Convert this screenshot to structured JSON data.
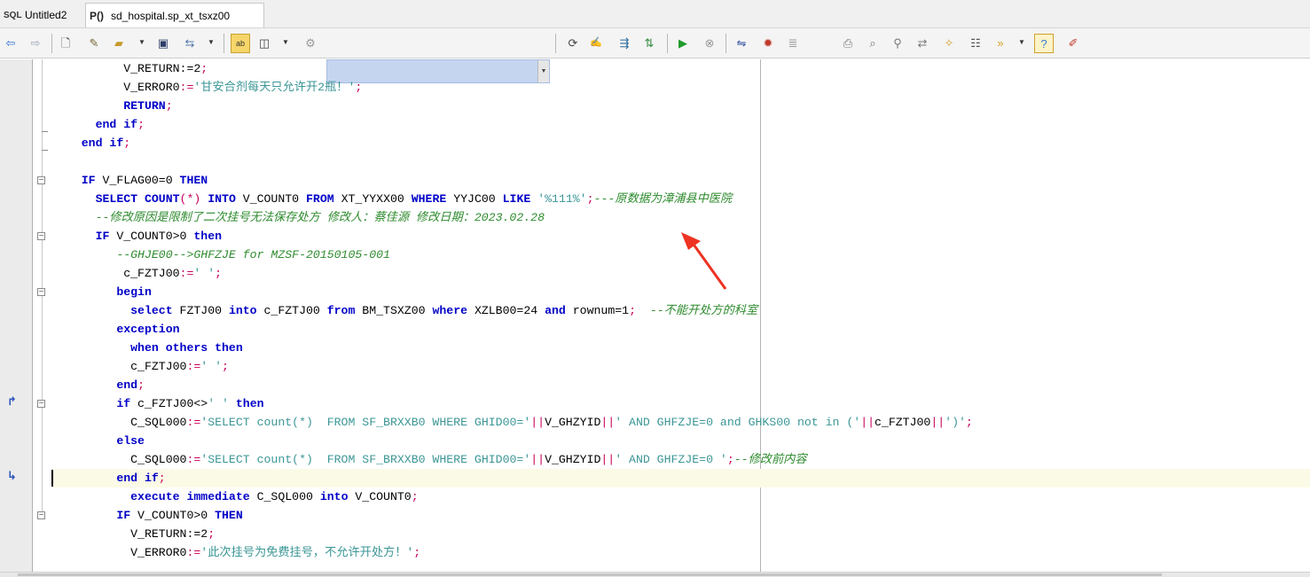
{
  "tabs": [
    {
      "label": "Untitled2",
      "icon": "sql-file-icon"
    },
    {
      "label": "sd_hospital.sp_xt_tsxz00",
      "icon": "procedure-icon",
      "icon_text": "P()"
    }
  ],
  "toolbar": {
    "icons": [
      "back-arrow-icon",
      "forward-arrow-icon",
      "new-file-icon",
      "open-folder-icon",
      "save-icon",
      "export-icon",
      "text-format-icon",
      "split-window-icon",
      "object-icon",
      "refresh-icon",
      "sql-script-icon",
      "send-icon",
      "compare-icon",
      "run-icon",
      "stop-icon",
      "debug-icon",
      "bug-icon",
      "indent-icon",
      "print-icon",
      "print-preview-icon",
      "find-icon",
      "replace-icon",
      "clean-icon",
      "schema-icon",
      "macro-icon",
      "help-icon",
      "pen-icon"
    ],
    "combo_value": ""
  },
  "colors": {
    "keyword": "#0000c8",
    "string": "#3c9696",
    "comment": "#2e8b2e",
    "operator": "#c8005a",
    "arrow": "#ee3322",
    "current_line": "#fbfae6"
  },
  "code_lines": [
    [
      {
        "t": "         V_RETURN:=2",
        "c": "plain"
      },
      {
        "t": ";",
        "c": "op"
      }
    ],
    [
      {
        "t": "         V_ERROR0",
        "c": "plain"
      },
      {
        "t": ":=",
        "c": "op"
      },
      {
        "t": "'甘安合剂每天只允许开2瓶！'",
        "c": "str"
      },
      {
        "t": ";",
        "c": "op"
      }
    ],
    [
      {
        "t": "         RETURN",
        "c": "kw"
      },
      {
        "t": ";",
        "c": "op"
      }
    ],
    [
      {
        "t": "     ",
        "c": "plain"
      },
      {
        "t": "end if",
        "c": "kw"
      },
      {
        "t": ";",
        "c": "op"
      }
    ],
    [
      {
        "t": "   ",
        "c": "plain"
      },
      {
        "t": "end if",
        "c": "kw"
      },
      {
        "t": ";",
        "c": "op"
      }
    ],
    [
      {
        "t": "",
        "c": "plain"
      }
    ],
    [
      {
        "t": "   ",
        "c": "plain"
      },
      {
        "t": "IF",
        "c": "kw"
      },
      {
        "t": " V_FLAG00=0 ",
        "c": "plain"
      },
      {
        "t": "THEN",
        "c": "kw"
      }
    ],
    [
      {
        "t": "     ",
        "c": "plain"
      },
      {
        "t": "SELECT COUNT",
        "c": "kw"
      },
      {
        "t": "(*)",
        "c": "op"
      },
      {
        "t": " INTO ",
        "c": "kw"
      },
      {
        "t": "V_COUNT0 ",
        "c": "plain"
      },
      {
        "t": "FROM",
        "c": "kw"
      },
      {
        "t": " XT_YYXX00 ",
        "c": "plain"
      },
      {
        "t": "WHERE",
        "c": "kw"
      },
      {
        "t": " YYJC00 ",
        "c": "plain"
      },
      {
        "t": "LIKE",
        "c": "kw"
      },
      {
        "t": " ",
        "c": "plain"
      },
      {
        "t": "'%111%'",
        "c": "str"
      },
      {
        "t": ";",
        "c": "op"
      },
      {
        "t": "---原数据为漳浦县中医院",
        "c": "cmt"
      }
    ],
    [
      {
        "t": "     ",
        "c": "plain"
      },
      {
        "t": "--修改原因是限制了二次挂号无法保存处方 修改人：蔡佳源 修改日期：2023.02.28",
        "c": "cmt"
      }
    ],
    [
      {
        "t": "     ",
        "c": "plain"
      },
      {
        "t": "IF",
        "c": "kw"
      },
      {
        "t": " V_COUNT0>0 ",
        "c": "plain"
      },
      {
        "t": "then",
        "c": "kw"
      }
    ],
    [
      {
        "t": "        ",
        "c": "plain"
      },
      {
        "t": "--GHJE00-->GHFZJE for MZSF-20150105-001",
        "c": "cmt"
      }
    ],
    [
      {
        "t": "         c_FZTJ00",
        "c": "plain"
      },
      {
        "t": ":=",
        "c": "op"
      },
      {
        "t": "' '",
        "c": "str"
      },
      {
        "t": ";",
        "c": "op"
      }
    ],
    [
      {
        "t": "        ",
        "c": "plain"
      },
      {
        "t": "begin",
        "c": "kw"
      }
    ],
    [
      {
        "t": "          ",
        "c": "plain"
      },
      {
        "t": "select",
        "c": "kw"
      },
      {
        "t": " FZTJ00 ",
        "c": "plain"
      },
      {
        "t": "into",
        "c": "kw"
      },
      {
        "t": " c_FZTJ00 ",
        "c": "plain"
      },
      {
        "t": "from",
        "c": "kw"
      },
      {
        "t": " BM_TSXZ00 ",
        "c": "plain"
      },
      {
        "t": "where",
        "c": "kw"
      },
      {
        "t": " XZLB00=24 ",
        "c": "plain"
      },
      {
        "t": "and",
        "c": "kw"
      },
      {
        "t": " rownum=1",
        "c": "plain"
      },
      {
        "t": ";",
        "c": "op"
      },
      {
        "t": "  ",
        "c": "plain"
      },
      {
        "t": "--不能开处方的科室",
        "c": "cmt"
      }
    ],
    [
      {
        "t": "        ",
        "c": "plain"
      },
      {
        "t": "exception",
        "c": "kw"
      }
    ],
    [
      {
        "t": "          ",
        "c": "plain"
      },
      {
        "t": "when others then",
        "c": "kw"
      }
    ],
    [
      {
        "t": "          c_FZTJ00",
        "c": "plain"
      },
      {
        "t": ":=",
        "c": "op"
      },
      {
        "t": "' '",
        "c": "str"
      },
      {
        "t": ";",
        "c": "op"
      }
    ],
    [
      {
        "t": "        ",
        "c": "plain"
      },
      {
        "t": "end",
        "c": "kw"
      },
      {
        "t": ";",
        "c": "op"
      }
    ],
    [
      {
        "t": "        ",
        "c": "plain"
      },
      {
        "t": "if",
        "c": "kw"
      },
      {
        "t": " c_FZTJ00<>",
        "c": "plain"
      },
      {
        "t": "' '",
        "c": "str"
      },
      {
        "t": " ",
        "c": "plain"
      },
      {
        "t": "then",
        "c": "kw"
      }
    ],
    [
      {
        "t": "          C_SQL000",
        "c": "plain"
      },
      {
        "t": ":=",
        "c": "op"
      },
      {
        "t": "'SELECT count(*)  FROM SF_BRXXB0 WHERE GHID00='",
        "c": "str"
      },
      {
        "t": "||",
        "c": "op"
      },
      {
        "t": "V_GHZYID",
        "c": "plain"
      },
      {
        "t": "||",
        "c": "op"
      },
      {
        "t": "' AND GHFZJE=0 and GHKS00 not in ('",
        "c": "str"
      },
      {
        "t": "||",
        "c": "op"
      },
      {
        "t": "c_FZTJ00",
        "c": "plain"
      },
      {
        "t": "||",
        "c": "op"
      },
      {
        "t": "')'",
        "c": "str"
      },
      {
        "t": ";",
        "c": "op"
      }
    ],
    [
      {
        "t": "        ",
        "c": "plain"
      },
      {
        "t": "else",
        "c": "kw"
      }
    ],
    [
      {
        "t": "          C_SQL000",
        "c": "plain"
      },
      {
        "t": ":=",
        "c": "op"
      },
      {
        "t": "'SELECT count(*)  FROM SF_BRXXB0 WHERE GHID00='",
        "c": "str"
      },
      {
        "t": "||",
        "c": "op"
      },
      {
        "t": "V_GHZYID",
        "c": "plain"
      },
      {
        "t": "||",
        "c": "op"
      },
      {
        "t": "' AND GHFZJE=0 '",
        "c": "str"
      },
      {
        "t": ";",
        "c": "op"
      },
      {
        "t": "--修改前内容",
        "c": "cmt"
      }
    ],
    [
      {
        "t": "        ",
        "c": "plain"
      },
      {
        "t": "end if",
        "c": "kw"
      },
      {
        "t": ";",
        "c": "op"
      }
    ],
    [
      {
        "t": "          ",
        "c": "plain"
      },
      {
        "t": "execute immediate",
        "c": "kw"
      },
      {
        "t": " C_SQL000 ",
        "c": "plain"
      },
      {
        "t": "into",
        "c": "kw"
      },
      {
        "t": " V_COUNT0",
        "c": "plain"
      },
      {
        "t": ";",
        "c": "op"
      }
    ],
    [
      {
        "t": "        ",
        "c": "plain"
      },
      {
        "t": "IF",
        "c": "kw"
      },
      {
        "t": " V_COUNT0>0 ",
        "c": "plain"
      },
      {
        "t": "THEN",
        "c": "kw"
      }
    ],
    [
      {
        "t": "          V_RETURN:=2",
        "c": "plain"
      },
      {
        "t": ";",
        "c": "op"
      }
    ],
    [
      {
        "t": "          V_ERROR0",
        "c": "plain"
      },
      {
        "t": ":=",
        "c": "op"
      },
      {
        "t": "'此次挂号为免费挂号，不允许开处方！'",
        "c": "str"
      },
      {
        "t": ";",
        "c": "op"
      }
    ]
  ],
  "gutter_markers": [
    {
      "line": 18,
      "glyph": "↱",
      "name": "breakpoint-start-icon"
    },
    {
      "line": 22,
      "glyph": "↳",
      "name": "breakpoint-end-icon"
    }
  ],
  "folds": [
    6,
    9,
    12,
    18,
    24
  ],
  "fold_ends": [
    3,
    4
  ],
  "current_line": 22,
  "annotation": {
    "type": "arrow",
    "name": "red-arrow-annotation"
  }
}
